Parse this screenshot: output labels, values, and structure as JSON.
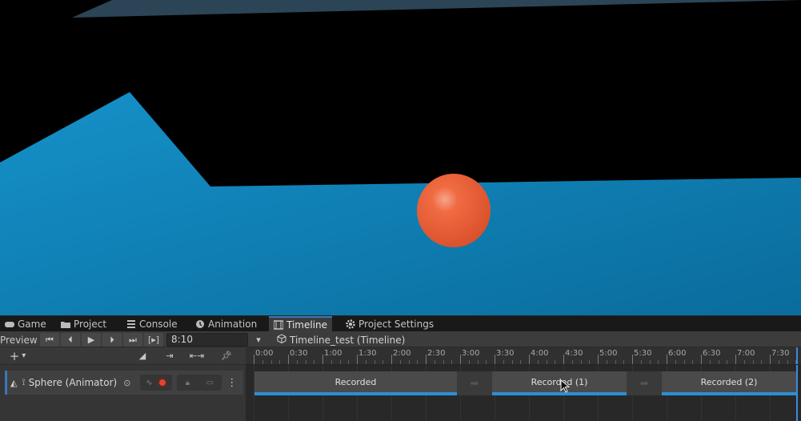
{
  "tabs": [
    {
      "label": "Game",
      "icon": "gamepad-icon"
    },
    {
      "label": "Project",
      "icon": "folder-icon"
    },
    {
      "label": "Console",
      "icon": "console-icon"
    },
    {
      "label": "Animation",
      "icon": "animation-icon"
    },
    {
      "label": "Timeline",
      "icon": "film-icon",
      "active": true
    },
    {
      "label": "Project Settings",
      "icon": "gear-icon"
    }
  ],
  "toolbar": {
    "preview_label": "Preview",
    "frame_mode_label": "[▸]",
    "current_time": "8:10",
    "timeline_asset": "Timeline_test (Timeline)"
  },
  "ruler": {
    "labels": [
      "0:00",
      "0:30",
      "1:00",
      "1:30",
      "2:00",
      "2:30",
      "3:00",
      "3:30",
      "4:00",
      "4:30",
      "5:00",
      "5:30",
      "6:00",
      "6:30",
      "7:00",
      "7:30"
    ]
  },
  "track": {
    "name": "Sphere (Animator)",
    "clips": [
      {
        "label": "Recorded"
      },
      {
        "label": "Recorded (1)"
      },
      {
        "label": "Recorded (2)"
      }
    ]
  },
  "colors": {
    "scene_ground": "#0f86bd",
    "sphere": "#f0613a",
    "accent": "#3a79bb",
    "clip_bar": "#2b8fd6"
  }
}
